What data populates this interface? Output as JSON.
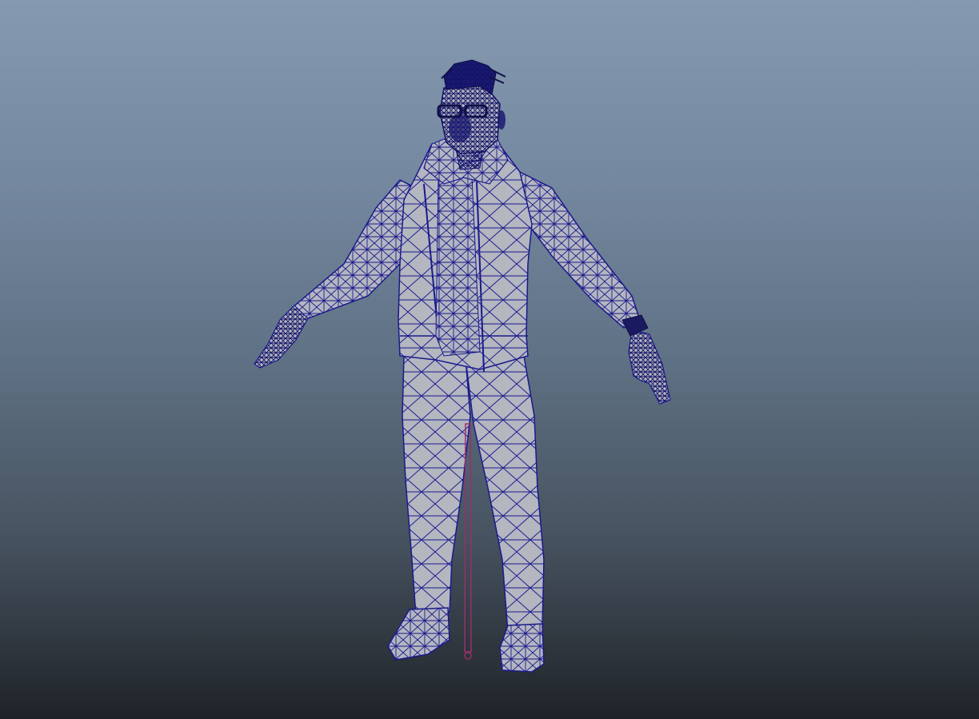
{
  "viewport": {
    "background_top": "#8599b1",
    "background_bottom": "#1f2328"
  },
  "model": {
    "pose": "A-pose",
    "display_mode": "wireframe-on-shaded",
    "surface_color": "#b4b6c0",
    "wire_color": "#1a1a8c",
    "dense_wire_color": "#121266",
    "joint_color": "#9a2f6a",
    "parts": [
      "head",
      "hair",
      "glasses",
      "jacket",
      "shirt",
      "pants",
      "hands",
      "shoes",
      "watch",
      "root-joint"
    ]
  }
}
